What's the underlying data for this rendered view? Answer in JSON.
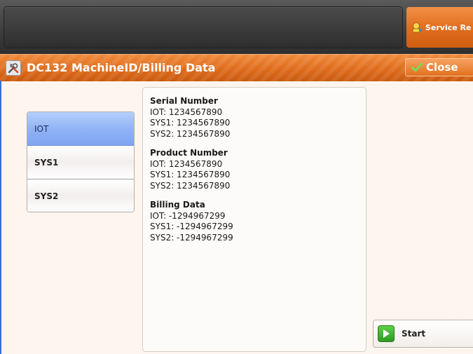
{
  "header": {
    "service_label": "Service Re",
    "icons": {
      "service": "service-rep-icon"
    }
  },
  "window": {
    "title": "DC132 MachineID/Billing Data",
    "close_label": "Close",
    "icons": {
      "title": "tools-icon",
      "close": "checkmark-icon"
    }
  },
  "tabs": [
    {
      "label": "IOT",
      "selected": true
    },
    {
      "label": "SYS1",
      "selected": false
    },
    {
      "label": "SYS2",
      "selected": false
    }
  ],
  "info": {
    "sections": [
      {
        "heading": "Serial Number",
        "lines": [
          "IOT: 1234567890",
          "SYS1: 1234567890",
          "SYS2: 1234567890"
        ]
      },
      {
        "heading": "Product Number",
        "lines": [
          "IOT: 1234567890",
          "SYS1: 1234567890",
          "SYS2: 1234567890"
        ]
      },
      {
        "heading": "Billing Data",
        "lines": [
          "IOT: -1294967299",
          "SYS1: -1294967299",
          "SYS2: -1294967299"
        ]
      }
    ]
  },
  "actions": {
    "start_label": "Start",
    "start_icon": "play-icon"
  },
  "colors": {
    "accent_orange": "#e06c1c",
    "selected_tab": "#8fb2f5",
    "start_green": "#3aa82b"
  }
}
